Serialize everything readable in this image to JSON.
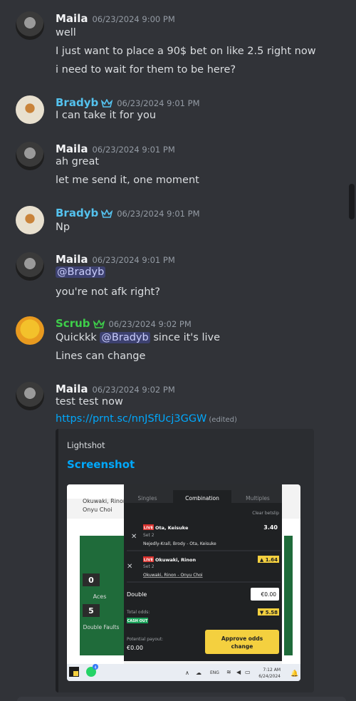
{
  "messages": [
    {
      "user": "Maila",
      "time": "06/23/2024 9:00 PM",
      "lines": [
        "well",
        "I just want to place a 90$ bet on like 2.5 right now",
        "i need to wait for them to be here?"
      ]
    },
    {
      "user": "Bradyb",
      "time": "06/23/2024 9:01 PM",
      "lines": [
        "I can take it for you"
      ]
    },
    {
      "user": "Maila",
      "time": "06/23/2024 9:01 PM",
      "lines": [
        "ah great",
        "let me send it, one moment"
      ]
    },
    {
      "user": "Bradyb",
      "time": "06/23/2024 9:01 PM",
      "lines": [
        "Np"
      ]
    },
    {
      "user": "Maila",
      "time": "06/23/2024 9:01 PM",
      "mention": "@Bradyb",
      "lines": [
        "you're not afk right?"
      ]
    },
    {
      "user": "Scrub",
      "time": "06/23/2024 9:02 PM",
      "line1_pre": "Quickkk",
      "line1_mention": "@Bradyb",
      "line1_post": "since it's live",
      "lines": [
        "Lines can change"
      ]
    },
    {
      "user": "Maila",
      "time": "06/23/2024 9:02 PM",
      "lines": [
        "test test now"
      ],
      "link": "https://prnt.sc/nnJSfUcj3GGW",
      "edited": "(edited)"
    }
  ],
  "embed": {
    "provider": "Lightshot",
    "title": "Screenshot",
    "screenshot": {
      "tabs": [
        "Singles",
        "Combination",
        "Multiples"
      ],
      "clear": "Clear betslip",
      "bg_names": [
        "Okuwaki, Rinon",
        "Onyu Choi"
      ],
      "score1": "0",
      "label1": "Aces",
      "score2": "5",
      "label2": "Double Faults",
      "live": "LIVE",
      "bet1": {
        "player": "Ota, Keisuke",
        "set": "Set 2",
        "match": "Nejedly-Krall, Brody - Ota, Keisuke",
        "odds": "3.40"
      },
      "bet2": {
        "player": "Okuwaki, Rinon",
        "set": "Set 2",
        "match": "Okuwaki, Rinon - Onyu Choi",
        "odds": "▲ 1.64"
      },
      "double_label": "Double",
      "stake": "€0.00",
      "total_label": "Total odds:",
      "total": "▼ 5.58",
      "cashout": "CASH OUT",
      "payout_label": "Potential payout:",
      "payout": "€0.00",
      "approve": [
        "Approve odds",
        "change"
      ],
      "taskbar": {
        "lang": "ENG",
        "time": "7:12 AM",
        "date": "6/24/2024",
        "badge": "4"
      }
    }
  },
  "colors": {
    "bg": "#313338",
    "blue_user": "#54c2ee",
    "green_user": "#3ecf4a",
    "link": "#00a8fc",
    "accent_yellow": "#f4d03f"
  }
}
